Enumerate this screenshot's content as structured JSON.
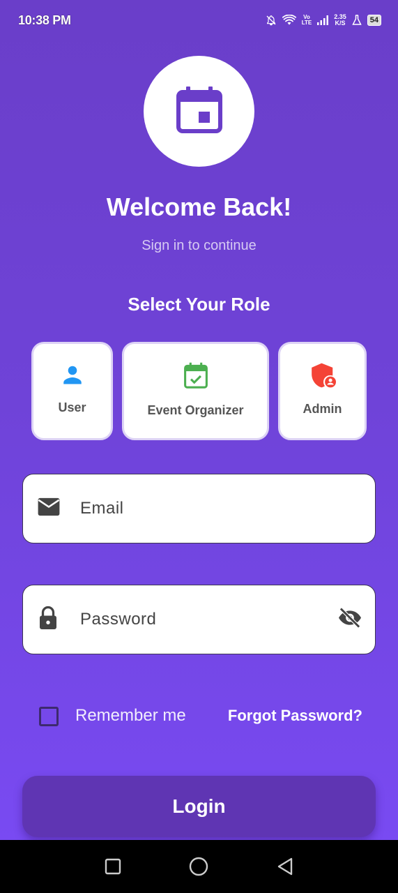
{
  "status_bar": {
    "time": "10:38 PM",
    "network_speed_value": "2.35",
    "network_speed_unit": "K/S",
    "volte_top": "Vo",
    "volte_bottom": "LTE",
    "battery": "54"
  },
  "header": {
    "logo_icon": "calendar-icon",
    "title": "Welcome Back!",
    "subtitle": "Sign in to continue"
  },
  "roles": {
    "heading": "Select Your Role",
    "items": [
      {
        "label": "User",
        "icon": "person-icon",
        "color": "#2196f3"
      },
      {
        "label": "Event Organizer",
        "icon": "calendar-check-icon",
        "color": "#4caf50"
      },
      {
        "label": "Admin",
        "icon": "admin-shield-icon",
        "color": "#f44336"
      }
    ]
  },
  "form": {
    "email_placeholder": "Email",
    "password_placeholder": "Password",
    "remember_label": "Remember me",
    "remember_checked": false,
    "forgot_label": "Forgot Password?",
    "login_label": "Login"
  },
  "colors": {
    "accent": "#6a3ec9",
    "button": "#5f35b3",
    "logo_icon": "#6a3ec9"
  }
}
